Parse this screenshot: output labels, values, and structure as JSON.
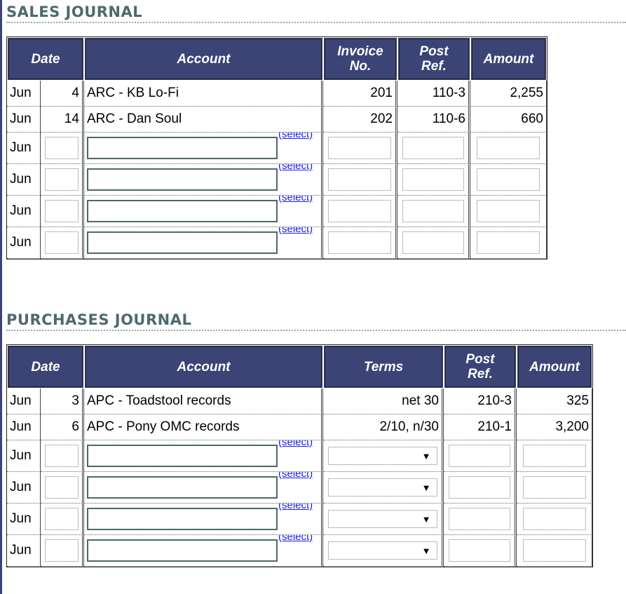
{
  "sales": {
    "title": "SALES JOURNAL",
    "headers": {
      "date": "Date",
      "account": "Account",
      "invoice": "Invoice No.",
      "post_ref": "Post Ref.",
      "amount": "Amount"
    },
    "rows": [
      {
        "month": "Jun",
        "day": "4",
        "account": "ARC - KB Lo-Fi",
        "invoice": "201",
        "post_ref": "110-3",
        "amount": "2,255"
      },
      {
        "month": "Jun",
        "day": "14",
        "account": "ARC - Dan Soul",
        "invoice": "202",
        "post_ref": "110-6",
        "amount": "660"
      }
    ],
    "entry_rows": [
      {
        "month": "Jun",
        "select_label": "(select)"
      },
      {
        "month": "Jun",
        "select_label": "(select)"
      },
      {
        "month": "Jun",
        "select_label": "(select)"
      },
      {
        "month": "Jun",
        "select_label": "(select)"
      }
    ]
  },
  "purchases": {
    "title": "PURCHASES JOURNAL",
    "headers": {
      "date": "Date",
      "account": "Account",
      "terms": "Terms",
      "post_ref": "Post Ref.",
      "amount": "Amount"
    },
    "rows": [
      {
        "month": "Jun",
        "day": "3",
        "account": "APC - Toadstool records",
        "terms": "net 30",
        "post_ref": "210-3",
        "amount": "325"
      },
      {
        "month": "Jun",
        "day": "6",
        "account": "APC - Pony OMC records",
        "terms": "2/10, n/30",
        "post_ref": "210-1",
        "amount": "3,200"
      }
    ],
    "entry_rows": [
      {
        "month": "Jun",
        "select_label": "(select)",
        "terms_arrow": "▼"
      },
      {
        "month": "Jun",
        "select_label": "(select)",
        "terms_arrow": "▼"
      },
      {
        "month": "Jun",
        "select_label": "(select)",
        "terms_arrow": "▼"
      },
      {
        "month": "Jun",
        "select_label": "(select)",
        "terms_arrow": "▼"
      }
    ]
  }
}
